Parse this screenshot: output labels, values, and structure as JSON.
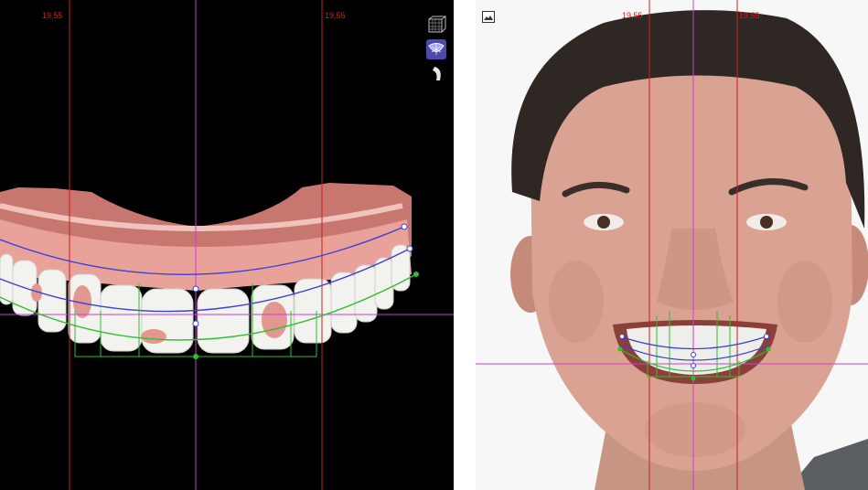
{
  "left_view": {
    "measure_left": "19,55",
    "measure_right": "19,55"
  },
  "right_view": {
    "measure_left": "19,55",
    "measure_right": "19,55"
  },
  "colors": {
    "guide_red": "#cc1f1f",
    "guide_magenta": "#d23bd2",
    "arch_blue": "#3e3ed8",
    "arch_green": "#2fbf2f",
    "gum_pink": "#e8a29a",
    "tooth_white": "#f2f2ee"
  },
  "icons": [
    "mesh-icon",
    "smile-design-icon",
    "arch-tool-icon",
    "photo-icon"
  ]
}
